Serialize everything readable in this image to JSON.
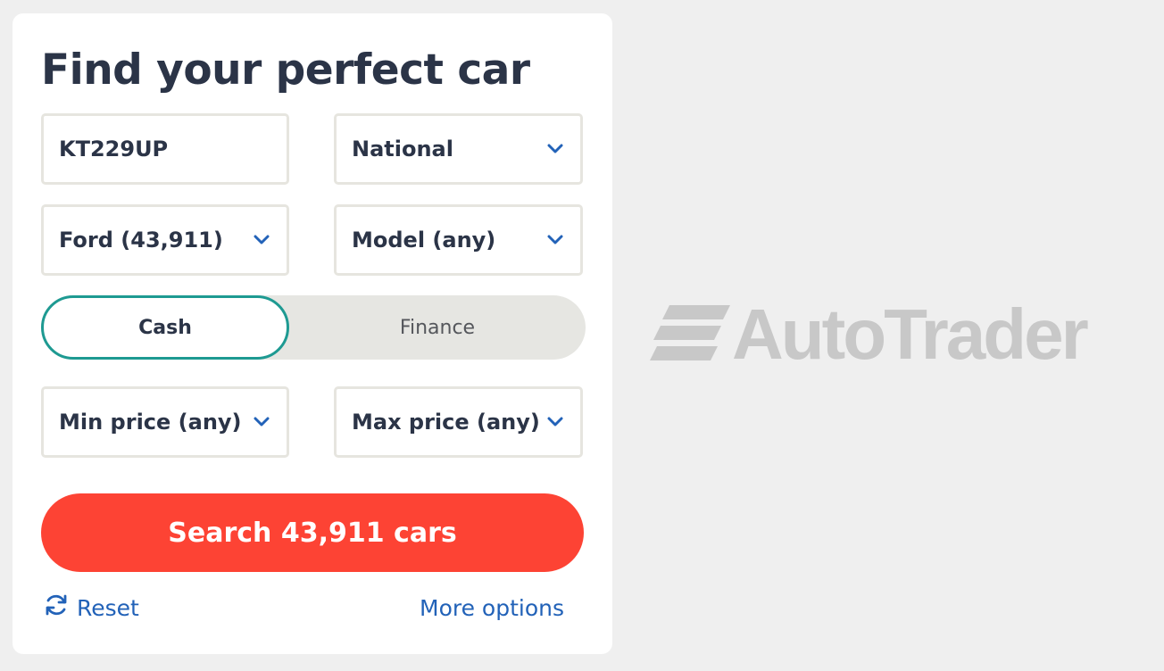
{
  "form": {
    "title": "Find your perfect car",
    "postcode": {
      "value": "KT229UP"
    },
    "distance": {
      "value": "National"
    },
    "make": {
      "value": "Ford (43,911)"
    },
    "model": {
      "value": "Model (any)"
    },
    "payment_toggle": {
      "cash": "Cash",
      "finance": "Finance",
      "selected": "Cash"
    },
    "min_price": {
      "value": "Min price (any)"
    },
    "max_price": {
      "value": "Max price (any)"
    },
    "search_button": "Search 43,911 cars",
    "reset_link": "Reset",
    "more_options_link": "More options"
  },
  "brand": {
    "logo_text": "AutoTrader"
  },
  "colors": {
    "background": "#efefef",
    "panel": "#ffffff",
    "text": "#2b3447",
    "accent_link": "#2262b8",
    "cta": "#fd4334",
    "toggle_border": "#1e9a92",
    "logo_grey": "#c8c8c8"
  },
  "icons": {
    "dropdown": "chevron-down-icon",
    "reset": "refresh-icon",
    "logo_mark": "autotrader-stripes-icon"
  }
}
